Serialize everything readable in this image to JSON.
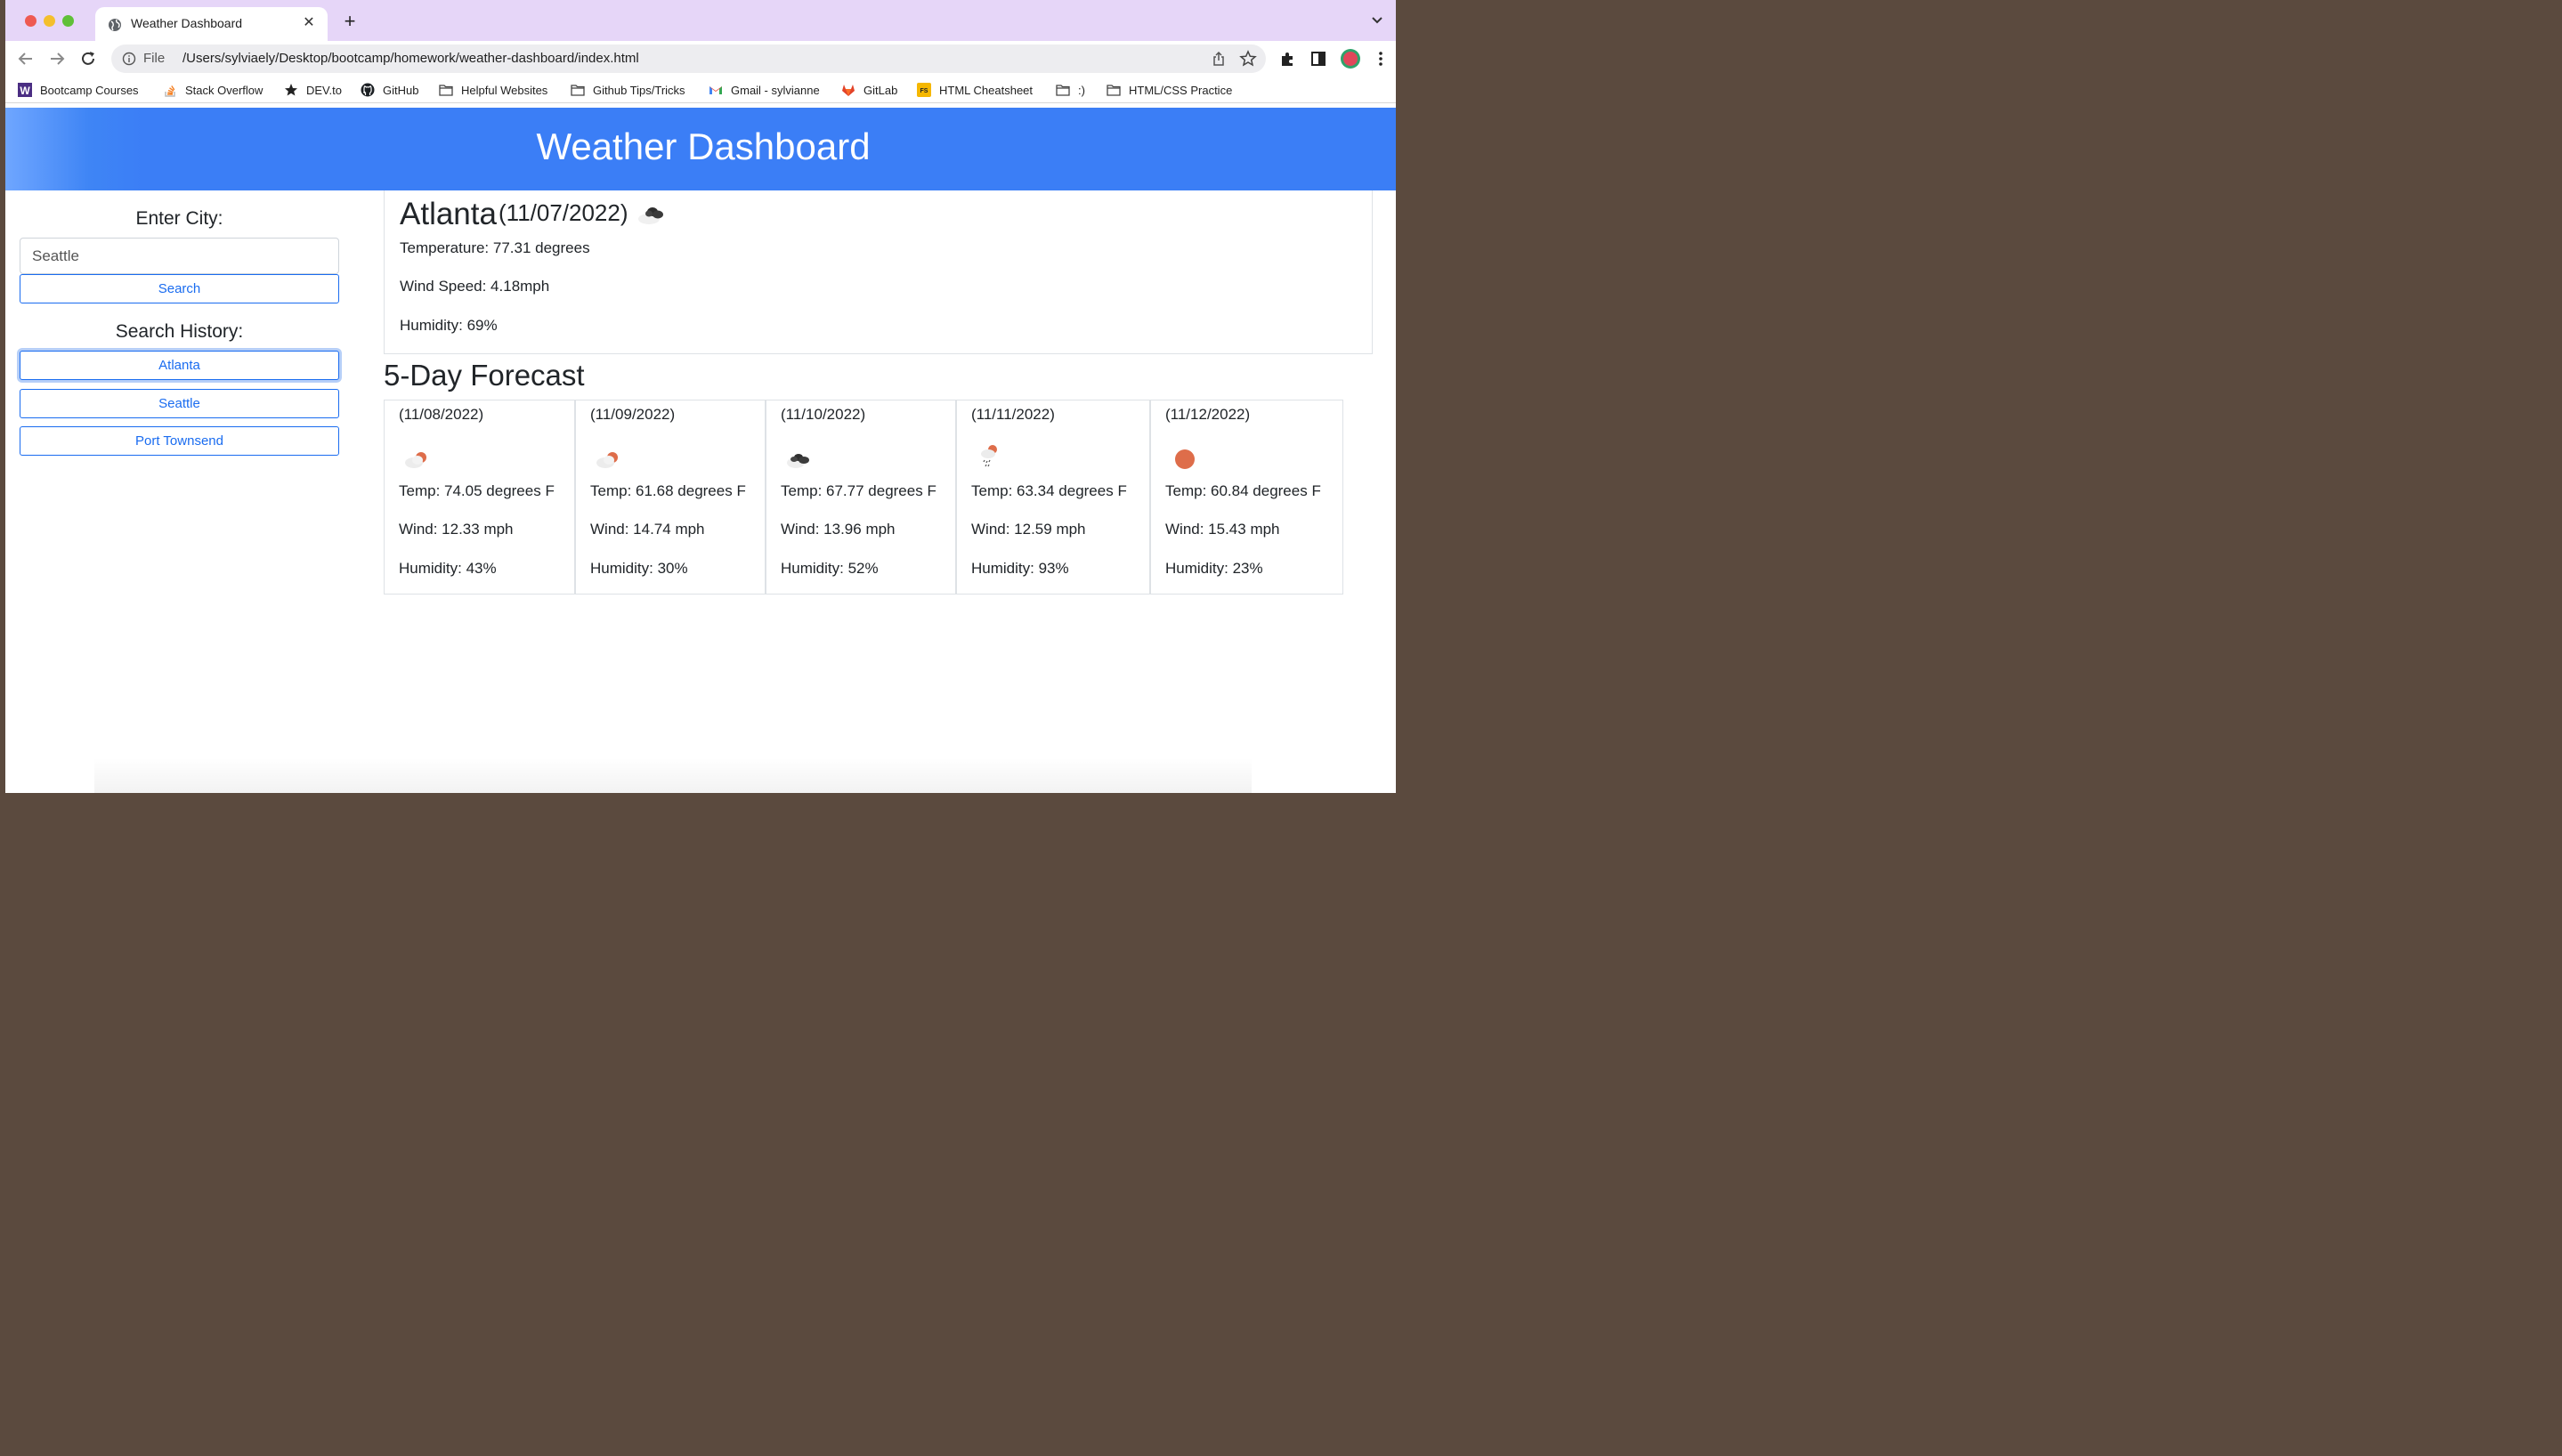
{
  "browser": {
    "tab_title": "Weather Dashboard",
    "tab_close": "✕",
    "new_tab": "+",
    "omnibox_scheme": "File",
    "url": "/Users/sylviaely/Desktop/bootcamp/homework/weather-dashboard/index.html"
  },
  "bookmarks": [
    {
      "label": "Bootcamp Courses",
      "icon": "w-logo-icon"
    },
    {
      "label": "Stack Overflow",
      "icon": "stack-overflow-icon"
    },
    {
      "label": "DEV.to",
      "icon": "star-icon"
    },
    {
      "label": "GitHub",
      "icon": "github-icon"
    },
    {
      "label": "Helpful Websites",
      "icon": "folder-icon"
    },
    {
      "label": "Github Tips/Tricks",
      "icon": "folder-icon"
    },
    {
      "label": "Gmail - sylvianne",
      "icon": "gmail-icon"
    },
    {
      "label": "GitLab",
      "icon": "gitlab-icon"
    },
    {
      "label": "HTML Cheatsheet",
      "icon": "fs-icon"
    },
    {
      "label": ":)",
      "icon": "folder-icon"
    },
    {
      "label": "HTML/CSS Practice",
      "icon": "folder-icon"
    }
  ],
  "header": {
    "title": "Weather Dashboard"
  },
  "sidebar": {
    "enter_city_label": "Enter City:",
    "city_input_value": "Seattle",
    "search_button": "Search",
    "history_label": "Search History:",
    "history": [
      "Atlanta",
      "Seattle",
      "Port Townsend"
    ]
  },
  "current": {
    "city": "Atlanta",
    "date": "(11/07/2022)",
    "icon": "partly-cloudy-dark-icon",
    "temperature": "Temperature: 77.31 degrees",
    "wind": "Wind Speed: 4.18mph",
    "humidity": "Humidity: 69%"
  },
  "forecast": {
    "title": "5-Day Forecast",
    "days": [
      {
        "date": "(11/08/2022)",
        "icon": "cloud-sun-icon",
        "temp": "Temp: 74.05 degrees F",
        "wind": "Wind: 12.33 mph",
        "humidity": "Humidity: 43%"
      },
      {
        "date": "(11/09/2022)",
        "icon": "cloud-sun-icon",
        "temp": "Temp: 61.68 degrees F",
        "wind": "Wind: 14.74 mph",
        "humidity": "Humidity: 30%"
      },
      {
        "date": "(11/10/2022)",
        "icon": "dark-clouds-icon",
        "temp": "Temp: 67.77 degrees F",
        "wind": "Wind: 13.96 mph",
        "humidity": "Humidity: 52%"
      },
      {
        "date": "(11/11/2022)",
        "icon": "rain-sun-icon",
        "temp": "Temp: 63.34 degrees F",
        "wind": "Wind: 12.59 mph",
        "humidity": "Humidity: 93%"
      },
      {
        "date": "(11/12/2022)",
        "icon": "sun-icon",
        "temp": "Temp: 60.84 degrees F",
        "wind": "Wind: 15.43 mph",
        "humidity": "Humidity: 23%"
      }
    ]
  },
  "colors": {
    "banner": "#3b7ef6",
    "button_primary": "#1a6cf0",
    "sun": "#de6d4a"
  }
}
